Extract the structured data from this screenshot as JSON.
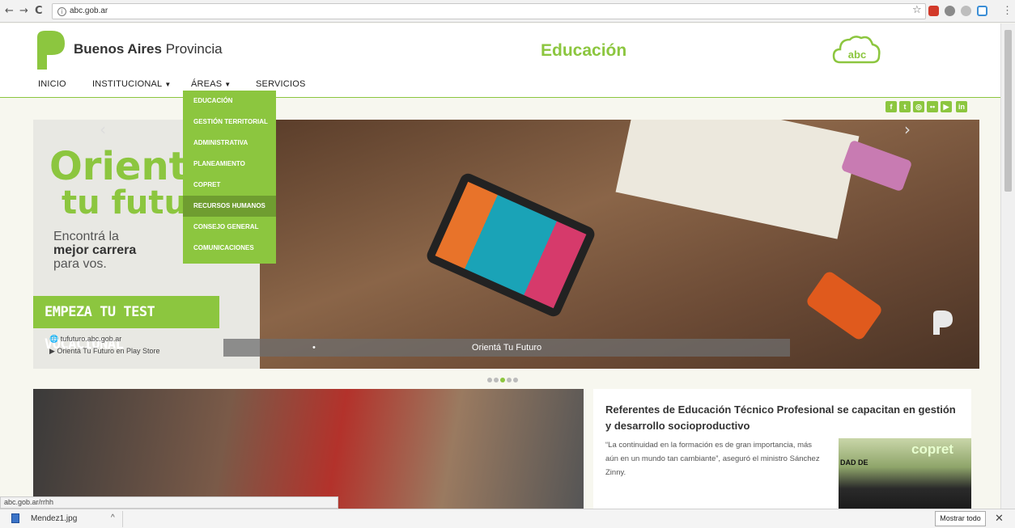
{
  "browser": {
    "back": "←",
    "forward": "→",
    "reload": "C",
    "url": "abc.gob.ar",
    "star": "☆",
    "menu": "⋮",
    "extension_icons": [
      "tag-extension-icon",
      "puzzle-extension-icon",
      "cloud-extension-icon",
      "cast-extension-icon"
    ]
  },
  "header": {
    "brand_bold": "Buenos Aires",
    "brand_rest": " Provincia",
    "section_title": "Educación",
    "abc_logo": "abc"
  },
  "nav": {
    "items": [
      {
        "label": "INICIO",
        "caret": ""
      },
      {
        "label": "INSTITUCIONAL",
        "caret": "▼"
      },
      {
        "label": "ÁREAS",
        "caret": "▼"
      },
      {
        "label": "SERVICIOS",
        "caret": ""
      }
    ]
  },
  "dropdown": {
    "items": [
      "EDUCACIÓN",
      "GESTIÓN TERRITORIAL",
      "ADMINISTRATIVA",
      "PLANEAMIENTO",
      "COPRET",
      "RECURSOS HUMANOS",
      "CONSEJO GENERAL",
      "COMUNICACIONES"
    ],
    "active_index": 5
  },
  "social": [
    "f",
    "t",
    "◎",
    "••",
    "▶",
    "in"
  ],
  "slider": {
    "headline_1": "Orientá",
    "headline_2": "tu futu",
    "tagline_1": "Encontrá la",
    "tagline_2": "mejor carrera",
    "tagline_3": "para vos.",
    "cta": "EMPEZA TU TEST VOCACIONAL",
    "link_1": "🌐 tufuturo.abc.gob.ar",
    "link_2": "▶ Orientá Tu Futuro en Play Store",
    "caption": "Orientá Tu Futuro",
    "caption_marker": "•",
    "prev": "‹",
    "next": "›",
    "dot_count": 5,
    "active_dot": 2
  },
  "news": {
    "title": "Referentes de Educación Técnico Profesional se capacitan en gestión y desarrollo socioproductivo",
    "body": "“La continuidad en la formación es de gran importancia, más aún en un mundo tan cambiante”, aseguró el ministro Sánchez Zinny.",
    "thumb_text": "DAD DE",
    "thumb_brand": "copret"
  },
  "status_bar": "abc.gob.ar/rrhh",
  "download_bar": {
    "file": "Mendez1.jpg",
    "caret": "^",
    "show_all": "Mostrar todo",
    "close": "✕"
  },
  "colors": {
    "accent": "#8cc63f",
    "accent_dark": "#6f9d30",
    "background": "#f7f7ef"
  }
}
